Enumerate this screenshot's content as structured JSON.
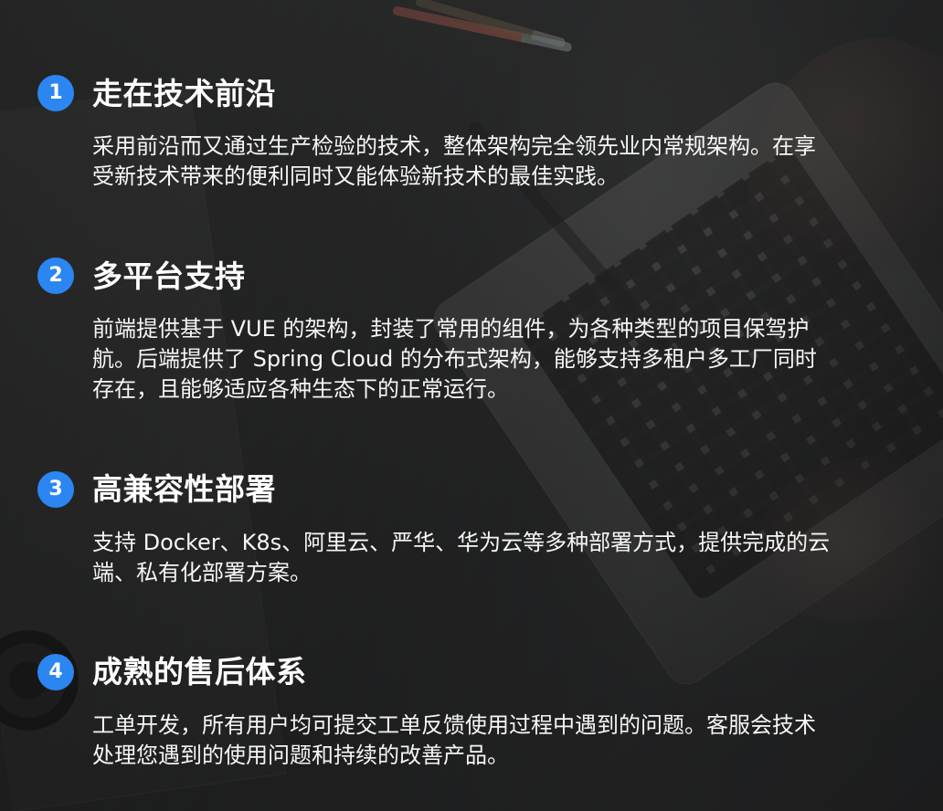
{
  "features": [
    {
      "number": "1",
      "title": "走在技术前沿",
      "text": "采用前沿而又通过生产检验的技术，整体架构完全领先业内常规架构。在享\n受新技术带来的便利同时又能体验新技术的最佳实践。"
    },
    {
      "number": "2",
      "title": "多平台支持",
      "text": "前端提供基于 VUE 的架构，封装了常用的组件，为各种类型的项目保驾护\n航。后端提供了 Spring Cloud 的分布式架构，能够支持多租户多工厂同时\n存在，且能够适应各种生态下的正常运行。"
    },
    {
      "number": "3",
      "title": "高兼容性部署",
      "text": "支持 Docker、K8s、阿里云、严华、华为云等多种部署方式，提供完成的云\n端、私有化部署方案。"
    },
    {
      "number": "4",
      "title": "成熟的售后体系",
      "text": "工单开发，所有用户均可提交工单反馈使用过程中遇到的问题。客服会技术\n处理您遇到的使用问题和持续的改善产品。"
    }
  ],
  "colors": {
    "accent": "#2b86f1",
    "text": "#ffffff"
  }
}
